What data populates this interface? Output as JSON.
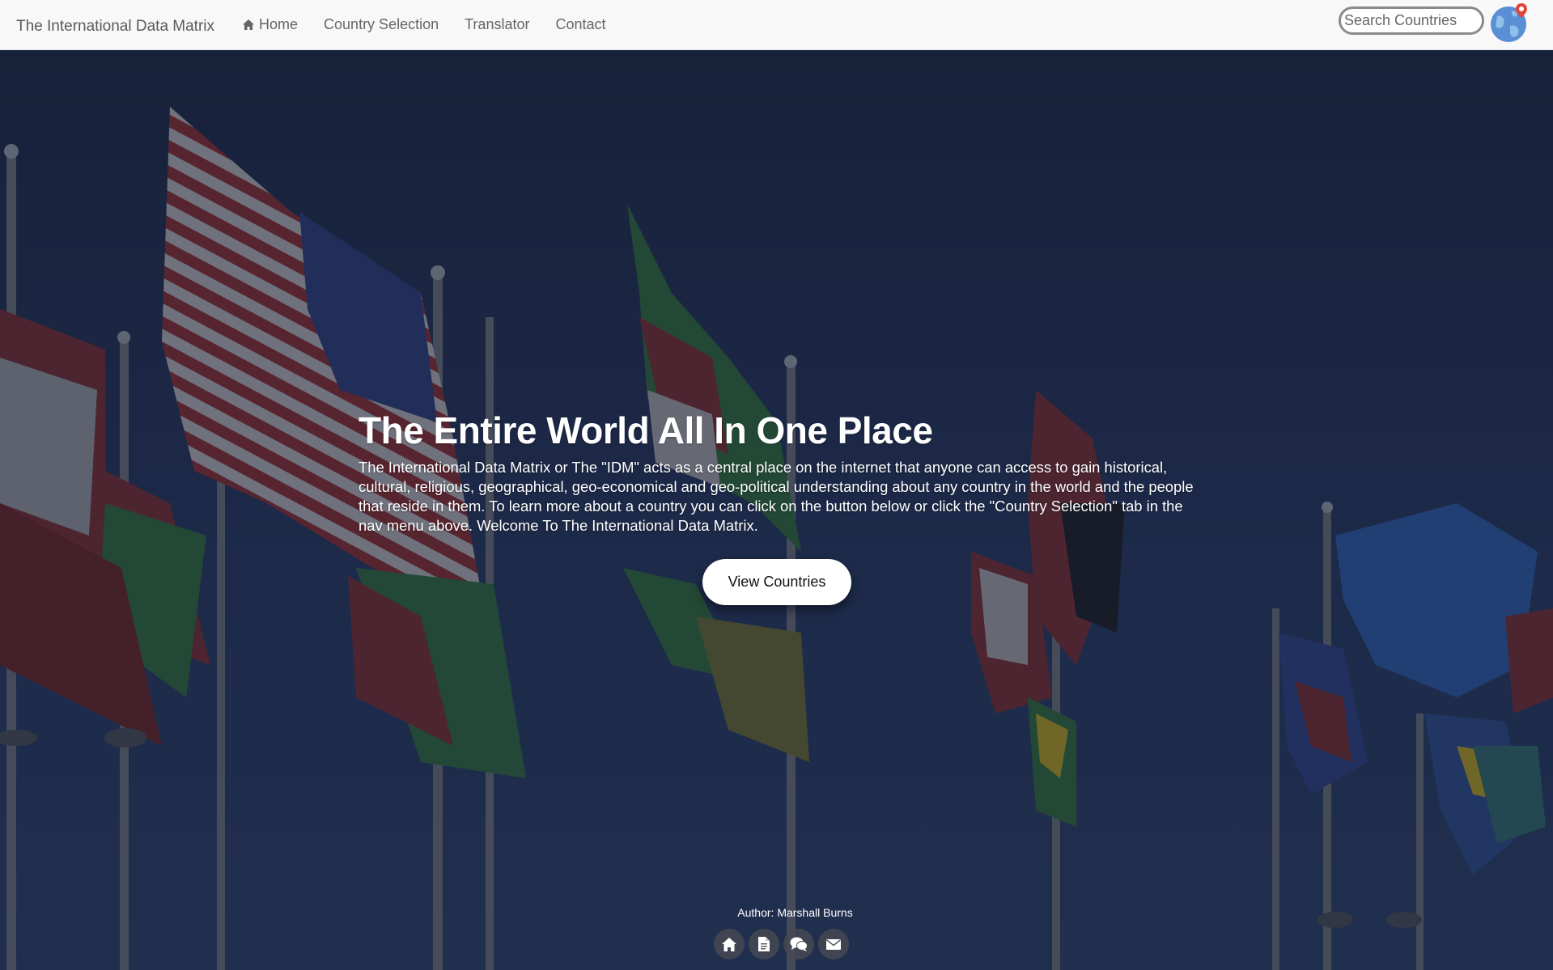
{
  "navbar": {
    "brand": "The International Data Matrix",
    "links": [
      {
        "label": "Home",
        "icon": "home-icon"
      },
      {
        "label": "Country Selection"
      },
      {
        "label": "Translator"
      },
      {
        "label": "Contact"
      }
    ],
    "search_placeholder": "Search Countries",
    "globe_icon": "globe-pin-icon"
  },
  "hero": {
    "title": "The Entire World All In One Place",
    "body": "The International Data Matrix or The \"IDM\" acts as a central place on the internet that anyone can access to gain historical, cultural, religious, geographical, geo-economical and geo-political understanding about any country in the world and the people that reside in them. To learn more about a country you can click on the button below or click the \"Country Selection\" tab in the nav menu above. Welcome To The International Data Matrix.",
    "cta_label": "View Countries",
    "background": "flags-on-poles-photo"
  },
  "footer": {
    "author": "Author: Marshall Burns",
    "social_icons": [
      "home-icon",
      "document-icon",
      "chat-icon",
      "mail-icon"
    ]
  },
  "colors": {
    "navbar_bg": "#f8f8f9",
    "hero_sky": "#1d2a48",
    "text_light": "#ffffff",
    "button_bg": "#ffffff"
  }
}
